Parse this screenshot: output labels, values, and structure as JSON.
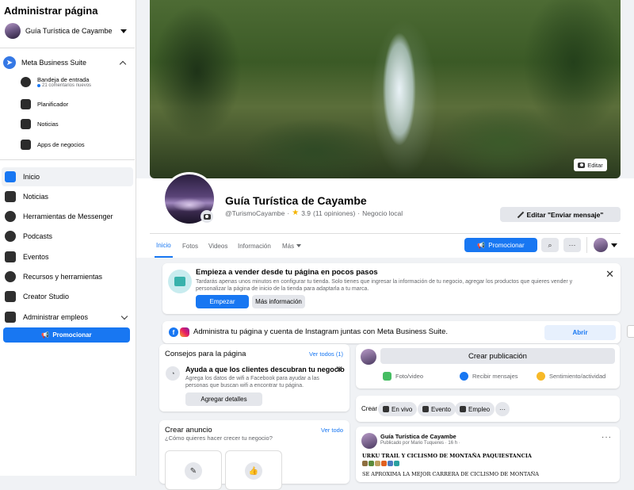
{
  "sidebar": {
    "title": "Administrar página",
    "page_selector": "Guía Turística de Cayambe",
    "meta_business_suite": "Meta Business Suite",
    "sub_items": [
      {
        "label": "Bandeja de entrada",
        "meta": "21 comentarios nuevos"
      },
      {
        "label": "Planificador"
      },
      {
        "label": "Noticias"
      },
      {
        "label": "Apps de negocios"
      }
    ],
    "nav": [
      {
        "label": "Inicio",
        "active": true
      },
      {
        "label": "Noticias"
      },
      {
        "label": "Herramientas de Messenger"
      },
      {
        "label": "Podcasts"
      },
      {
        "label": "Eventos"
      },
      {
        "label": "Recursos y herramientas"
      },
      {
        "label": "Creator Studio"
      },
      {
        "label": "Administrar empleos"
      }
    ],
    "promote_label": "Promocionar"
  },
  "cover": {
    "edit_label": "Editar"
  },
  "page": {
    "name": "Guía Turística de Cayambe",
    "handle": "@TurismoCayambe",
    "separator": "·",
    "rating": "3.9",
    "reviews": "(11 opiniones)",
    "category": "Negocio local",
    "edit_button": "Editar \"Enviar mensaje\""
  },
  "tabs": [
    {
      "label": "Inicio",
      "active": true
    },
    {
      "label": "Fotos"
    },
    {
      "label": "Videos"
    },
    {
      "label": "Información"
    },
    {
      "label": "Más"
    }
  ],
  "tab_actions": {
    "promote": "Promocionar"
  },
  "sell_card": {
    "title": "Empieza a vender desde tu página en pocos pasos",
    "text": "Tardarás apenas unos minutos en configurar tu tienda. Solo tienes que ingresar la información de tu negocio, agregar los productos que quieres vender y personalizar la página de inicio de la tienda para adaptarla a tu marca.",
    "start": "Empezar",
    "more": "Más información"
  },
  "ig_card": {
    "text": "Administra tu página y cuenta de Instagram juntas con Meta Business Suite.",
    "open": "Abrir"
  },
  "tips": {
    "title": "Consejos para la página",
    "link": "Ver todos (1)",
    "tip_title": "Ayuda a que los clientes descubran tu negocio",
    "tip_text": "Agrega los datos de wifi a Facebook para ayudar a las personas que buscan wifi a encontrar tu página.",
    "button": "Agregar detalles"
  },
  "ad": {
    "title": "Crear anuncio",
    "link": "Ver todo",
    "subtitle": "¿Cómo quieres hacer crecer tu negocio?"
  },
  "composer": {
    "button": "Crear publicación",
    "actions": [
      {
        "label": "Foto/video",
        "color": "#45bd62"
      },
      {
        "label": "Recibir mensajes",
        "color": "#1877f2"
      },
      {
        "label": "Sentimiento/actividad",
        "color": "#f7b928"
      }
    ]
  },
  "create_row": {
    "label": "Crear",
    "pills": [
      {
        "label": "En vivo"
      },
      {
        "label": "Evento"
      },
      {
        "label": "Empleo"
      }
    ],
    "more": "···"
  },
  "post": {
    "author": "Guía Turística de Cayambe",
    "meta": "Publicado por Mario Tuqueres · 16 h ·",
    "headline": "URKU TRAIL Y CICLISMO DE MONTAÑA PAQUIESTANCIA",
    "body": "SE APROXIMA LA MEJOR CARRERA DE CICLISMO DE MONTAÑA"
  },
  "icons": {
    "caret": "caret-down-icon",
    "camera": "camera-icon",
    "search": "search-icon",
    "more": "ellipsis-icon"
  },
  "colors": {
    "brand": "#1877f2",
    "background": "#f0f2f5"
  }
}
